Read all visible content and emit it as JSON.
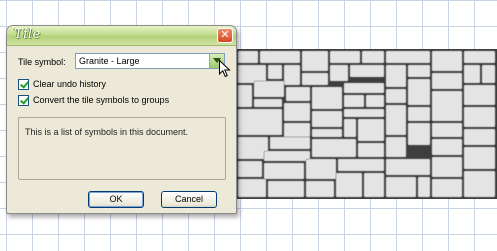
{
  "dialog": {
    "title": "Tile",
    "close_glyph": "✕",
    "symbol_label": "Tile symbol:",
    "symbol_value": "Granite - Large",
    "clear_undo_label": "Clear undo history",
    "clear_undo_checked": true,
    "convert_groups_label": "Convert the tile symbols to groups",
    "convert_groups_checked": true,
    "info_text": "This is a list of symbols in this document.",
    "ok_label": "OK",
    "cancel_label": "Cancel"
  },
  "icons": {
    "close": "close-icon",
    "dropdown": "chevron-down-icon",
    "check": "check-icon",
    "cursor": "mouse-pointer-icon"
  },
  "colors": {
    "grid_line": "#c9d3e6",
    "dialog_bg": "#ece9d8",
    "titlebar_green": "#b4d17a",
    "close_red": "#d24a22",
    "grout": "#3e3e3e",
    "stone": "#e4e4e4"
  }
}
